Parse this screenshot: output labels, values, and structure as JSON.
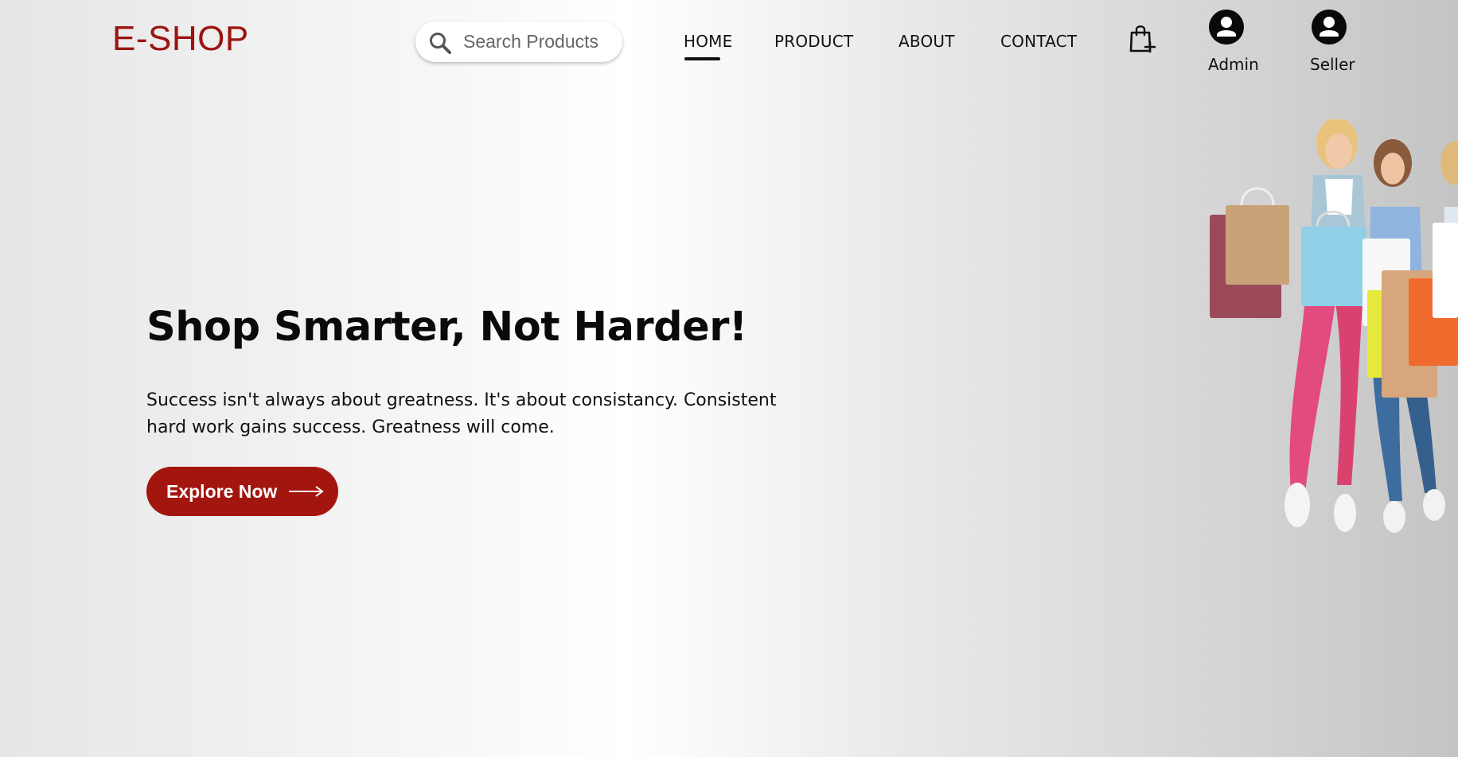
{
  "header": {
    "logo": "E-SHOP",
    "search": {
      "placeholder": "Search Products",
      "value": ""
    },
    "nav": [
      {
        "label": "HOME",
        "active": true
      },
      {
        "label": "PRODUCT",
        "active": false
      },
      {
        "label": "ABOUT",
        "active": false
      },
      {
        "label": "CONTACT",
        "active": false
      }
    ],
    "cart_icon": "shopping-bag-plus-icon",
    "users": [
      {
        "label": "Admin",
        "icon": "user-circle-icon"
      },
      {
        "label": "Seller",
        "icon": "user-circle-icon"
      }
    ]
  },
  "hero": {
    "title": "Shop Smarter, Not Harder!",
    "description": "Success isn't always about greatness. It's about consistancy. Consistent hard work gains success. Greatness will come.",
    "cta_label": "Explore Now",
    "image": "women-with-shopping-bags"
  },
  "colors": {
    "brand": "#9b1410",
    "cta": "#a3160f",
    "text": "#111111"
  }
}
